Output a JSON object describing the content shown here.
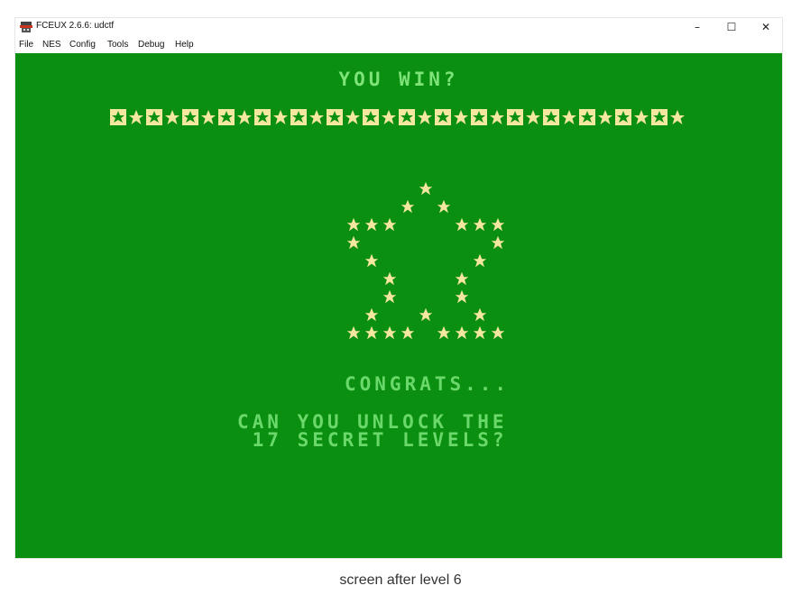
{
  "window": {
    "title": "FCEUX 2.6.6: udctf",
    "icon": "fceux-app-icon",
    "controls": {
      "minimize": "–",
      "maximize": "☐",
      "close": "✕"
    }
  },
  "menu": {
    "items": [
      "File",
      "NES",
      "Config",
      "Tools",
      "Debug",
      "Help"
    ]
  },
  "game": {
    "headline": "YOU WIN?",
    "border_pattern": "boxed-star-and-star alternating",
    "star_figure": "pentagram of star glyphs",
    "congrats": "CONGRATS...",
    "message_line1": "CAN YOU UNLOCK THE",
    "message_line2": " 17 SECRET LEVELS?",
    "colors": {
      "background": "#0b8f10",
      "star": "#f5e6a0",
      "text": "#6ad86a"
    }
  },
  "caption": "screen after level 6"
}
